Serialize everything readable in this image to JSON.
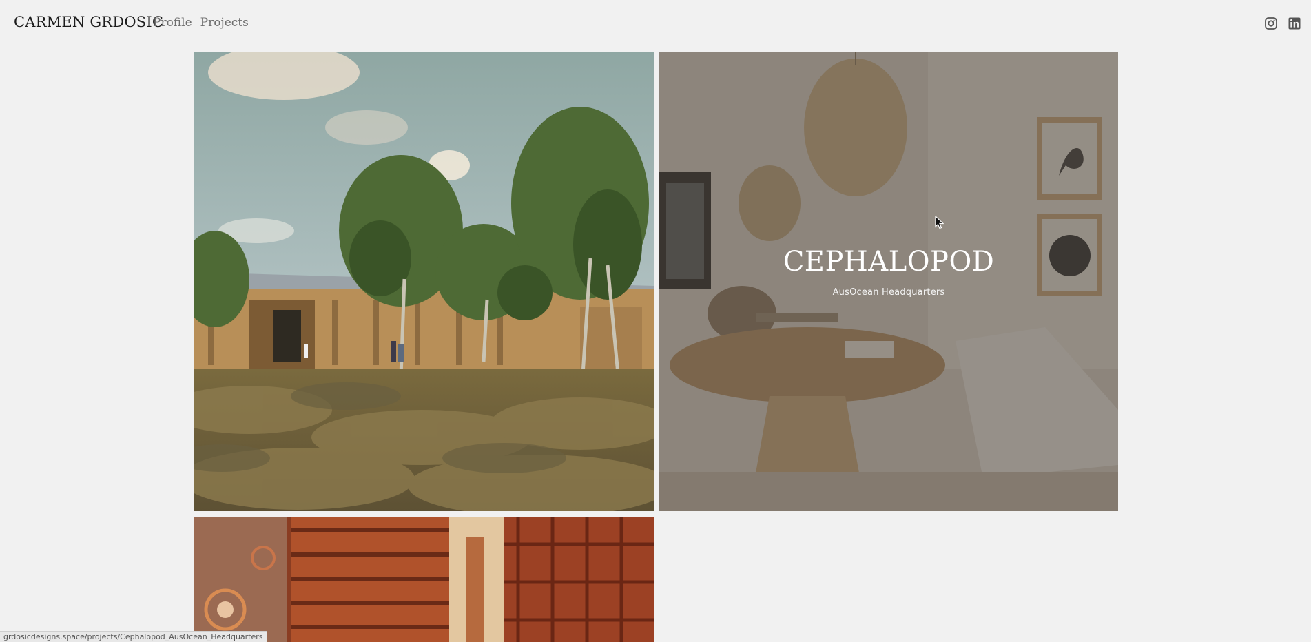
{
  "header": {
    "site_name": "CARMEN GRDOSIC",
    "nav": [
      {
        "label": "Profile"
      },
      {
        "label": "Projects"
      }
    ],
    "socials": [
      {
        "icon": "instagram-icon"
      },
      {
        "icon": "linkedin-icon"
      }
    ]
  },
  "projects": [
    {
      "title": "",
      "subtitle": ""
    },
    {
      "title": "CEPHALOPOD",
      "subtitle": "AusOcean Headquarters"
    },
    {
      "title": "",
      "subtitle": ""
    }
  ],
  "status_bar": {
    "url": "grdosicdesigns.space/projects/Cephalopod_AusOcean_Headquarters"
  },
  "colors": {
    "background": "#f1f1f1",
    "text": "#1c1c1c",
    "nav_text": "#6e6e6e",
    "overlay": "rgba(70,64,56,0.52)"
  }
}
